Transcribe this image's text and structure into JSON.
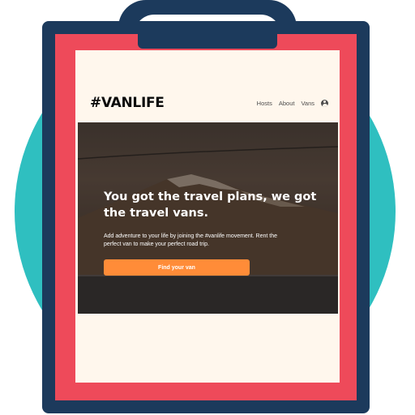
{
  "site": {
    "logo": "#VANLIFE"
  },
  "nav": {
    "links": [
      "Hosts",
      "About",
      "Vans"
    ],
    "user_icon": "user-circle-icon"
  },
  "hero": {
    "title": "You got the travel plans, we got the travel vans.",
    "description": "Add adventure to your life by joining the #vanlife movement. Rent the perfect van to make your perfect road trip.",
    "cta_label": "Find your van"
  },
  "colors": {
    "clipboard_frame": "#1c3a5c",
    "clipboard_red": "#ee4a5a",
    "background_circle": "#2fbfc0",
    "paper": "#fff7ed",
    "cta": "#ff8c38"
  }
}
